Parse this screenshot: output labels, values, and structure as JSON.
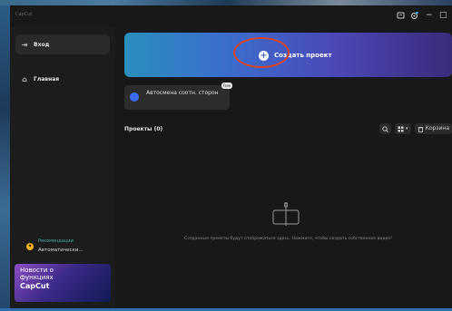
{
  "app": {
    "logo": "CapCut",
    "window_buttons": {
      "minimize": "−",
      "maximize": "□"
    }
  },
  "sidebar": {
    "items": [
      {
        "icon": "login-icon",
        "label": "Вход"
      },
      {
        "icon": "home-icon",
        "label": "Главная"
      }
    ],
    "promo_auto": {
      "line1": "Рекомендации",
      "line2": "Автоматически..."
    },
    "promo_news": {
      "line1": "Новости о",
      "line2": "функциях",
      "line3": "CapCut"
    }
  },
  "main": {
    "create_project": "Создать проект",
    "tool_card": {
      "label": "Автосмена соотн. сторон",
      "badge": "Free"
    },
    "projects_title": "Проекты  (0)",
    "toolbar": {
      "search_icon": "search-icon",
      "view_icon": "grid-view-icon",
      "trash_label": "Корзина"
    },
    "empty_text": "Созданные проекты будут отображаться здесь. Нажмите, чтобы создать собственное видео!"
  },
  "colors": {
    "app_bg": "#181818",
    "sidebar_bg": "#1c1c1c",
    "banner_start": "#2a8fbd",
    "banner_end": "#3a2b7a",
    "annotation": "#d2452e"
  }
}
